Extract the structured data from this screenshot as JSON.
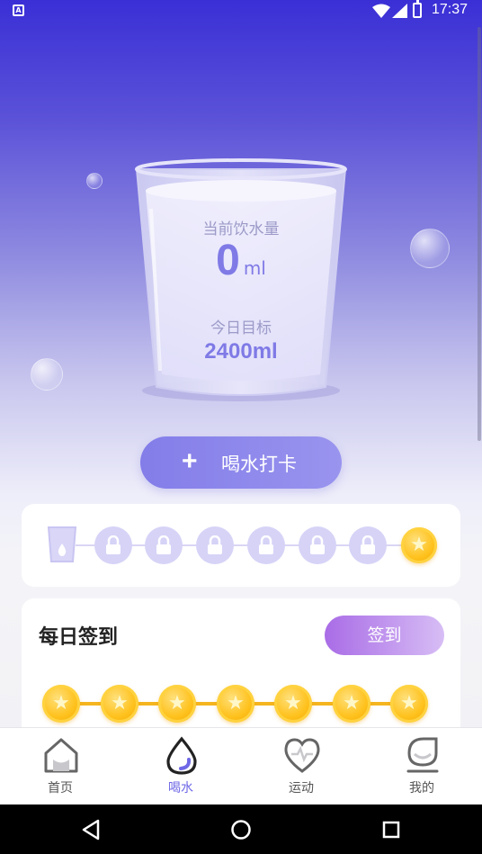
{
  "status_bar": {
    "time": "17:37",
    "notification_icon": "A"
  },
  "water": {
    "current_label": "当前饮水量",
    "current_value": "0",
    "current_unit": "ml",
    "target_label": "今日目标",
    "target_value": "2400ml"
  },
  "drink_button": {
    "icon": "plus-icon",
    "label": "喝水打卡"
  },
  "progress": {
    "completed_glasses": 0,
    "steps": [
      "glass-icon",
      "lock-icon",
      "lock-icon",
      "lock-icon",
      "lock-icon",
      "lock-icon",
      "lock-icon",
      "star-coin-icon"
    ]
  },
  "daily_sign": {
    "title": "每日签到",
    "button_label": "签到",
    "days": 7
  },
  "tabs": [
    {
      "label": "首页",
      "icon": "home-icon",
      "active": false
    },
    {
      "label": "喝水",
      "icon": "water-drop-icon",
      "active": true
    },
    {
      "label": "运动",
      "icon": "heart-pulse-icon",
      "active": false
    },
    {
      "label": "我的",
      "icon": "profile-icon",
      "active": false
    }
  ],
  "colors": {
    "primary": "#7f7ae6",
    "accent_sign": "#a96ce6",
    "coin": "#ffc21e",
    "header_gradient_top": "#3a2fd6"
  }
}
